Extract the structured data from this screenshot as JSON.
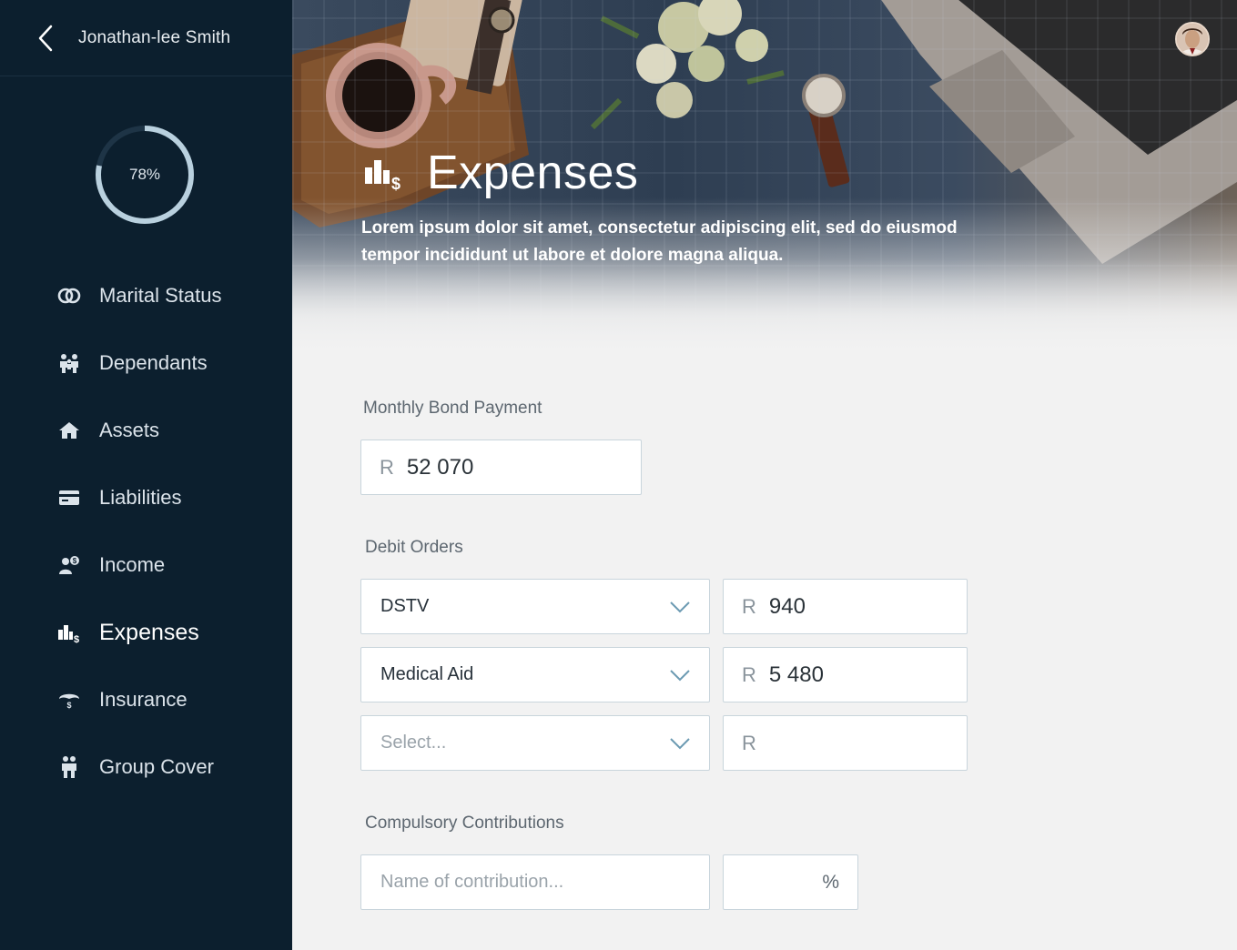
{
  "user": {
    "name": "Jonathan-lee Smith"
  },
  "progress": {
    "value": 78,
    "label": "78%"
  },
  "nav": [
    {
      "label": "Marital Status",
      "icon": "rings-icon",
      "active": false
    },
    {
      "label": "Dependants",
      "icon": "family-icon",
      "active": false
    },
    {
      "label": "Assets",
      "icon": "home-icon",
      "active": false
    },
    {
      "label": "Liabilities",
      "icon": "card-icon",
      "active": false
    },
    {
      "label": "Income",
      "icon": "income-icon",
      "active": false
    },
    {
      "label": "Expenses",
      "icon": "expenses-icon",
      "active": true
    },
    {
      "label": "Insurance",
      "icon": "umbrella-icon",
      "active": false
    },
    {
      "label": "Group Cover",
      "icon": "group-icon",
      "active": false
    }
  ],
  "hero": {
    "title": "Expenses",
    "description": "Lorem ipsum dolor sit amet, consectetur adipiscing elit, sed do eiusmod tempor incididunt ut labore et dolore magna aliqua."
  },
  "form": {
    "bond": {
      "label": "Monthly Bond Payment",
      "currency": "R",
      "value": "52 070"
    },
    "debit": {
      "label": "Debit Orders",
      "rows": [
        {
          "select": "DSTV",
          "currency": "R",
          "amount": "940"
        },
        {
          "select": "Medical Aid",
          "currency": "R",
          "amount": "5 480"
        },
        {
          "select": "Select...",
          "currency": "R",
          "amount": ""
        }
      ]
    },
    "compulsory": {
      "label": "Compulsory Contributions",
      "name_placeholder": "Name of contribution...",
      "percent_symbol": "%"
    }
  },
  "colors": {
    "sidebar": "#0c1f2e",
    "background": "#f2f2f2",
    "ring": "#b9d0de"
  }
}
